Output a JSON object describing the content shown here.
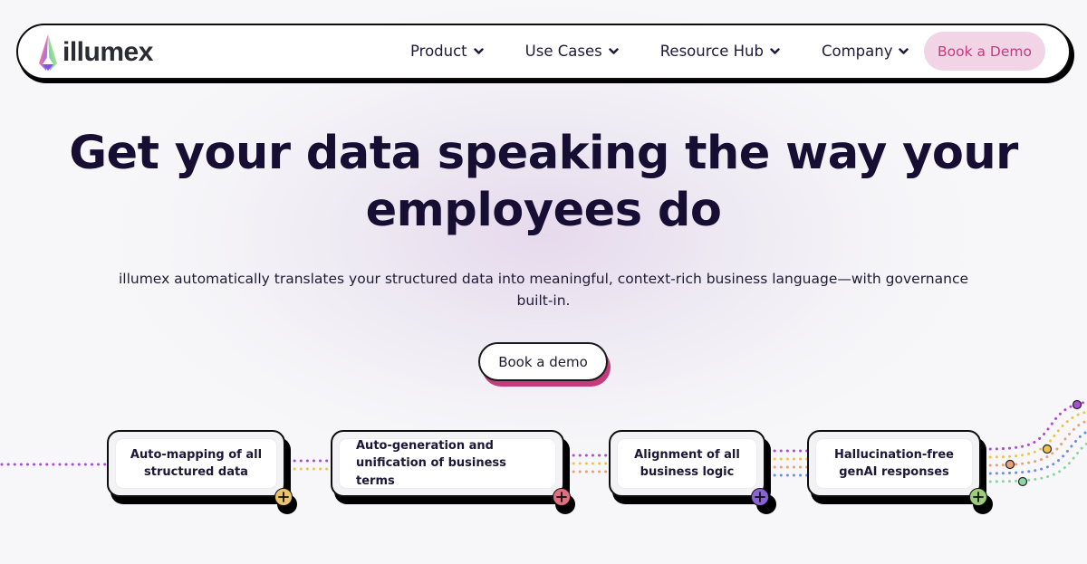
{
  "brand": {
    "name": "illumex"
  },
  "nav": {
    "items": [
      {
        "label": "Product",
        "icon": "chevron-down-icon"
      },
      {
        "label": "Use Cases",
        "icon": "chevron-down-icon"
      },
      {
        "label": "Resource Hub",
        "icon": "chevron-down-icon"
      },
      {
        "label": "Company",
        "icon": "chevron-down-icon"
      }
    ],
    "cta_label": "Book a Demo"
  },
  "hero": {
    "title_line1": "Get your data speaking the way your",
    "title_line2": "employees do",
    "subtitle_line1": "illumex automatically translates your structured data into meaningful, context-rich business language—with governance",
    "subtitle_line2": "built-in.",
    "cta_label": "Book a demo"
  },
  "flow": {
    "steps": [
      {
        "line1": "Auto-mapping of all",
        "line2": "structured data",
        "accent": "#e9c46a",
        "icon": "plus-icon"
      },
      {
        "line1": "Auto-generation and",
        "line2": "unification of business terms",
        "accent": "#e0707f",
        "icon": "plus-icon"
      },
      {
        "line1": "Alignment of all",
        "line2": "business logic",
        "accent": "#8a63d2",
        "icon": "plus-icon"
      },
      {
        "line1": "Hallucination-free",
        "line2": "genAI responses",
        "accent": "#9ccc7c",
        "icon": "plus-icon"
      }
    ],
    "line_colors": [
      "#a84fd1",
      "#efc44e",
      "#e6a27e",
      "#6f8ee0",
      "#8fd4a6"
    ]
  },
  "colors": {
    "text_dark": "#160f33",
    "cta_pink_bg": "#f1d5e6",
    "cta_pink_text": "#c5397f",
    "cta_shadow": "#c63a7e"
  }
}
